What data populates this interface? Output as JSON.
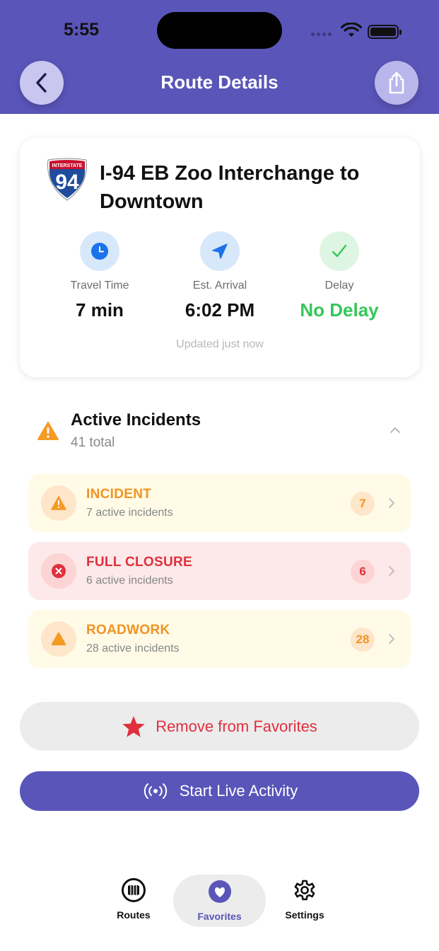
{
  "status_bar": {
    "time": "5:55"
  },
  "header": {
    "title": "Route Details"
  },
  "route": {
    "shield_top": "INTERSTATE",
    "shield_number": "94",
    "title": "I-94 EB Zoo Interchange to Downtown",
    "metrics": [
      {
        "label": "Travel Time",
        "value": "7 min",
        "icon": "clock-icon",
        "color": "#1a73e8"
      },
      {
        "label": "Est. Arrival",
        "value": "6:02 PM",
        "icon": "navigation-arrow-icon",
        "color": "#1a73e8"
      },
      {
        "label": "Delay",
        "value": "No Delay",
        "icon": "checkmark-icon",
        "color": "#34c759"
      }
    ],
    "updated": "Updated just now"
  },
  "incidents": {
    "title": "Active Incidents",
    "total": "41 total",
    "rows": [
      {
        "name": "INCIDENT",
        "desc": "7 active incidents",
        "count": "7"
      },
      {
        "name": "FULL CLOSURE",
        "desc": "6 active incidents",
        "count": "6"
      },
      {
        "name": "ROADWORK",
        "desc": "28 active incidents",
        "count": "28"
      }
    ]
  },
  "actions": {
    "favorite": "Remove from Favorites",
    "live": "Start Live Activity"
  },
  "tabs": [
    {
      "label": "Routes",
      "icon": "map-icon"
    },
    {
      "label": "Favorites",
      "icon": "heart-icon"
    },
    {
      "label": "Settings",
      "icon": "gear-icon"
    }
  ],
  "colors": {
    "brand": "#5a55b9",
    "incident": "#f29324",
    "closure": "#e0303d",
    "success": "#34c759"
  }
}
